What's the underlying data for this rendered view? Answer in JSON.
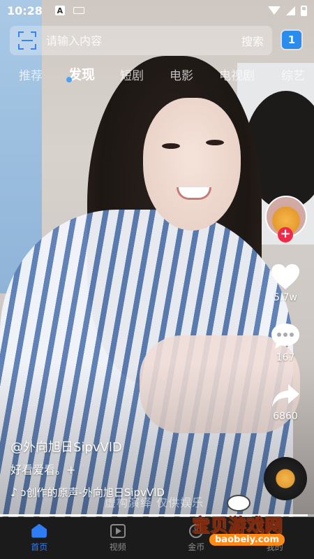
{
  "status_bar": {
    "time": "10:28",
    "notif_icon": "A",
    "icons": [
      "font-a-icon",
      "keyboard-icon",
      "wifi-icon",
      "signal-icon",
      "battery-icon"
    ]
  },
  "search": {
    "placeholder": "请输入内容",
    "button_label": "搜索",
    "badge_count": "1"
  },
  "tabs": [
    {
      "label": "推荐",
      "active": false
    },
    {
      "label": "发现",
      "active": true
    },
    {
      "label": "短剧",
      "active": false
    },
    {
      "label": "电影",
      "active": false
    },
    {
      "label": "电视剧",
      "active": false
    },
    {
      "label": "综艺",
      "active": false
    }
  ],
  "actions": {
    "likes": "5.7w",
    "comments": "167",
    "shares": "6860"
  },
  "video": {
    "author": "@外向旭日SipvVlD",
    "caption": "好看爱看。+",
    "music": "ɔ创作的原声-外向旭日SipvVlD",
    "subtitle": "虚构演绎 仅供娱乐",
    "progress": 0.98
  },
  "bottom_nav": [
    {
      "label": "首页",
      "active": true,
      "icon": "home-icon"
    },
    {
      "label": "视频",
      "active": false,
      "icon": "play-box-icon"
    },
    {
      "label": "金币",
      "active": false,
      "icon": "coin-icon"
    },
    {
      "label": "我的",
      "active": false,
      "icon": "user-icon"
    }
  ],
  "watermark": {
    "title": "宝贝游戏网",
    "url": "baobeiy.com"
  },
  "colors": {
    "accent": "#2f7df4",
    "follow": "#f0284a"
  }
}
